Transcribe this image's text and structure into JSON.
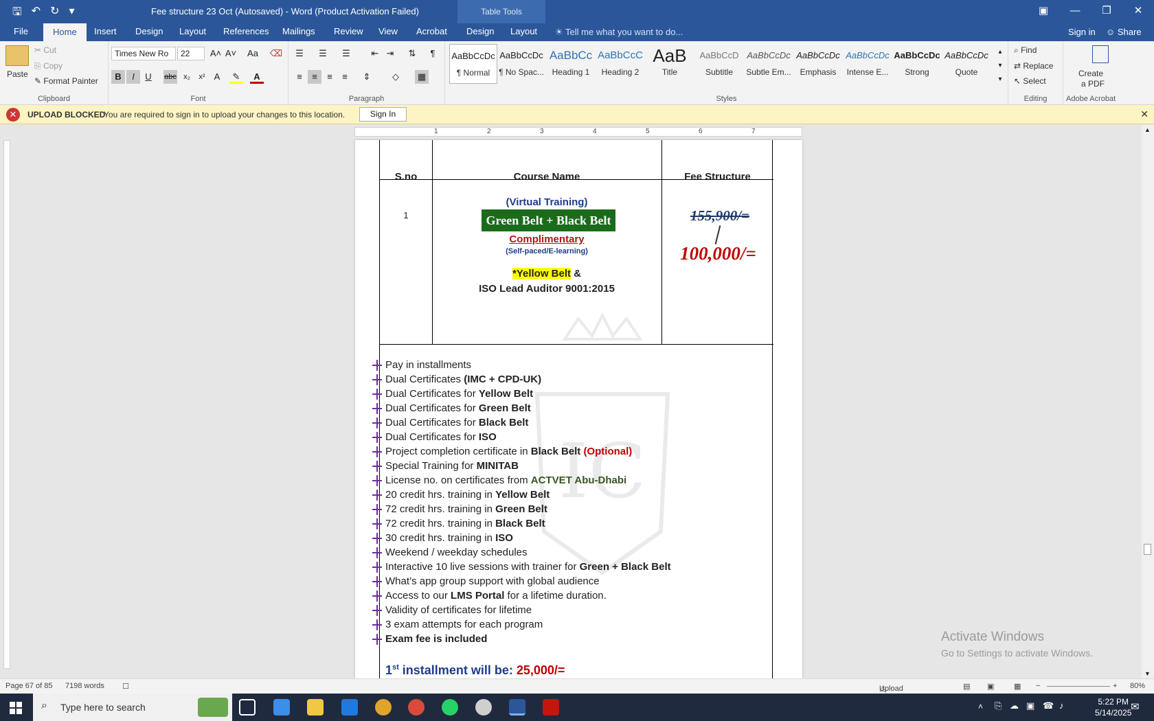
{
  "window": {
    "title": "Fee structure 23 Oct (Autosaved) - Word (Product Activation Failed)",
    "context_tab": "Table Tools",
    "accent": "#2b579a"
  },
  "tabs": [
    "File",
    "Home",
    "Insert",
    "Design",
    "Layout",
    "References",
    "Mailings",
    "Review",
    "View",
    "Acrobat",
    "Design",
    "Layout"
  ],
  "tell_me": "Tell me what you want to do...",
  "account": {
    "signin": "Sign in",
    "share": "Share"
  },
  "ribbon": {
    "clipboard": {
      "paste": "Paste",
      "cut": "Cut",
      "copy": "Copy",
      "format_painter": "Format Painter",
      "label": "Clipboard"
    },
    "font": {
      "name": "Times New Ro",
      "size": "22",
      "label": "Font"
    },
    "paragraph": {
      "label": "Paragraph"
    },
    "styles": {
      "label": "Styles",
      "items": [
        {
          "preview": "AaBbCcDc",
          "name": "¶ Normal"
        },
        {
          "preview": "AaBbCcDc",
          "name": "¶ No Spac..."
        },
        {
          "preview": "AaBbCc",
          "name": "Heading 1"
        },
        {
          "preview": "AaBbCcC",
          "name": "Heading 2"
        },
        {
          "preview": "AaB",
          "name": "Title"
        },
        {
          "preview": "AaBbCcD",
          "name": "Subtitle"
        },
        {
          "preview": "AaBbCcDc",
          "name": "Subtle Em..."
        },
        {
          "preview": "AaBbCcDc",
          "name": "Emphasis"
        },
        {
          "preview": "AaBbCcDc",
          "name": "Intense E..."
        },
        {
          "preview": "AaBbCcDc",
          "name": "Strong"
        },
        {
          "preview": "AaBbCcDc",
          "name": "Quote"
        }
      ]
    },
    "editing": {
      "find": "Find",
      "replace": "Replace",
      "select": "Select",
      "label": "Editing"
    },
    "acrobat": {
      "create_pdf_1": "Create",
      "create_pdf_2": "a PDF",
      "label": "Adobe Acrobat"
    }
  },
  "message_bar": {
    "title": "UPLOAD BLOCKED",
    "text": "You are required to sign in to upload your changes to this location.",
    "button": "Sign In"
  },
  "ruler_numbers": [
    "1",
    "2",
    "3",
    "4",
    "5",
    "6",
    "7"
  ],
  "document": {
    "table_headers": [
      "S.no",
      "Course Name",
      "Fee Structure"
    ],
    "row": {
      "sno": "1",
      "virtual": "(Virtual Training)",
      "belt": "Green Belt + Black Belt",
      "complimentary": "Complimentary",
      "selfpaced": "(Self-paced/E-learning)",
      "yellow": "*Yellow Belt",
      "amp": " &",
      "iso": "ISO Lead Auditor 9001:2015",
      "old_fee": "155,900/=",
      "new_fee": "100,000/="
    },
    "features": [
      {
        "pre": "Pay in installments",
        "b": "",
        "post": ""
      },
      {
        "pre": "Dual Certificates ",
        "b": "(IMC + CPD-UK)",
        "post": ""
      },
      {
        "pre": "Dual Certificates for ",
        "b": "Yellow Belt",
        "post": ""
      },
      {
        "pre": "Dual Certificates for ",
        "b": "Green Belt",
        "post": ""
      },
      {
        "pre": "Dual Certificates for ",
        "b": "Black Belt",
        "post": ""
      },
      {
        "pre": "Dual Certificates for ",
        "b": "ISO",
        "post": ""
      },
      {
        "pre": " Project completion certificate in ",
        "b": "Black Belt",
        "post": "",
        "red": " (Optional)"
      },
      {
        "pre": "Special Training for ",
        "b": "MINITAB",
        "post": ""
      },
      {
        "pre": "License no. on certificates from ",
        "b": "",
        "post": "",
        "green": "ACTVET Abu-Dhabi"
      },
      {
        "pre": "20 credit hrs. training in ",
        "b": "Yellow Belt",
        "post": ""
      },
      {
        "pre": "72 credit hrs. training in ",
        "b": "Green Belt",
        "post": ""
      },
      {
        "pre": "72 credit hrs. training in ",
        "b": "Black Belt",
        "post": ""
      },
      {
        "pre": "30 credit hrs. training in ",
        "b": "ISO",
        "post": ""
      },
      {
        "pre": " Weekend / weekday schedules",
        "b": "",
        "post": ""
      },
      {
        "pre": "Interactive 10 live sessions with trainer for ",
        "b": "Green + Black Belt",
        "post": ""
      },
      {
        "pre": "What’s app group support with global audience",
        "b": "",
        "post": ""
      },
      {
        "pre": "Access to our ",
        "b": "LMS Portal",
        "post": " for a lifetime duration."
      },
      {
        "pre": "Validity of certificates for lifetime",
        "b": "",
        "post": ""
      },
      {
        "pre": "3 exam attempts for each program",
        "b": "",
        "post": ""
      },
      {
        "pre": "",
        "b": "Exam fee is included",
        "post": ""
      }
    ],
    "installment": {
      "num": "1",
      "sup": "st",
      "text": " installment will be: ",
      "amount": "25,000/="
    }
  },
  "activate": {
    "line1": "Activate Windows",
    "line2": "Go to Settings to activate Windows."
  },
  "status": {
    "page": "Page 67 of 85",
    "words": "7198 words",
    "upload": "Upload Failed",
    "zoom": "80%"
  },
  "taskbar": {
    "search": "Type here to search",
    "time": "5:22 PM",
    "date": "5/14/2025"
  }
}
